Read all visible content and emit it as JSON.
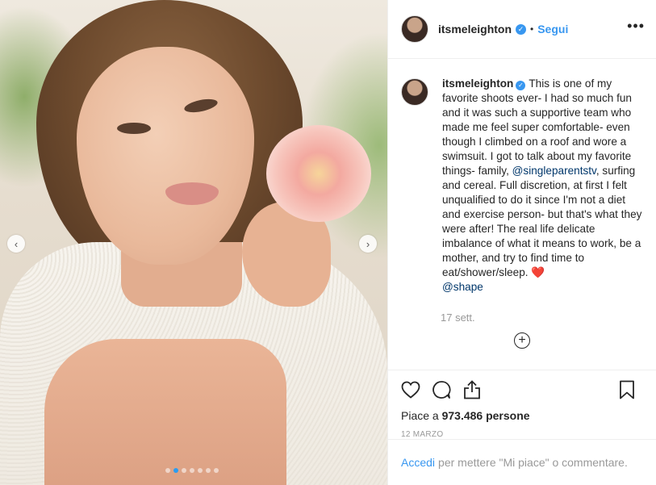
{
  "post": {
    "username": "itsmeleighton",
    "follow_label": "Segui",
    "separator": "•",
    "more_label": "•••",
    "caption": {
      "text_before_mention": "This is one of my favorite shoots ever- I had so much fun and it was such a supportive team who made me feel super comfortable- even though I climbed on a roof and wore a swimsuit. I got to talk about my favorite things- family, ",
      "mention_1": "@singleparentstv",
      "text_after_mention": ", surfing and cereal. Full discretion, at first I felt unqualified to do it since I'm not a diet and exercise person- but that's what they were after! The real life delicate imbalance of what it means to work, be a mother, and try to find time to eat/shower/sleep. ",
      "emoji": "❤️",
      "mention_2": "@shape"
    },
    "caption_time": "17 sett.",
    "load_more_label": "+",
    "likes_prefix": "Piace a ",
    "likes_count": "973.486 persone",
    "date": "12 MARZO",
    "login_link": "Accedi",
    "login_text": "per mettere \"Mi piace\" o commentare."
  },
  "carousel": {
    "prev": "‹",
    "next": "›",
    "total_slides": 7,
    "active_slide": 2
  },
  "colors": {
    "accent": "#3897f0",
    "mention": "#00376b",
    "muted": "#999999",
    "active_dot": "#2b9cf0"
  },
  "icons": [
    "heart-icon",
    "comment-icon",
    "share-icon",
    "bookmark-icon",
    "verified-icon",
    "plus-circle-icon"
  ]
}
